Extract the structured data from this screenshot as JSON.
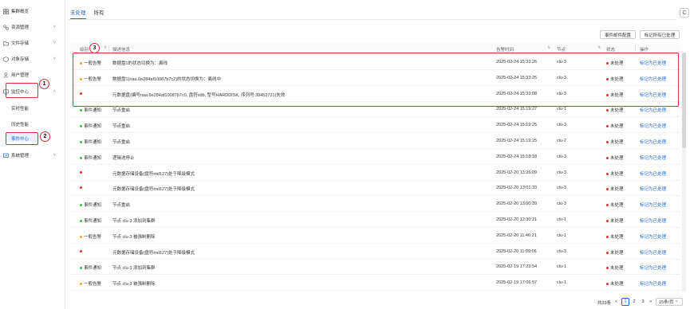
{
  "colors": {
    "accent": "#1f66d8",
    "highlight": "#d9303c",
    "level_general": "#f0a020",
    "level_notice": "#3bb54a",
    "level_red": "#e03030",
    "status_unhandled": "#e03030"
  },
  "sidebar": {
    "items": [
      {
        "label": "集群概览",
        "icon": "grid-icon",
        "chevron": ""
      },
      {
        "label": "资源管理",
        "icon": "resource-icon",
        "chevron": "˅"
      },
      {
        "label": "文件存储",
        "icon": "folder-icon",
        "chevron": "˅"
      },
      {
        "label": "对象存储",
        "icon": "object-icon",
        "chevron": "˅"
      },
      {
        "label": "用户管理",
        "icon": "user-icon",
        "chevron": ""
      },
      {
        "label": "监控中心",
        "icon": "monitor-icon",
        "chevron": "˄"
      },
      {
        "label": "系统管理",
        "icon": "settings-icon",
        "chevron": "˅"
      }
    ],
    "sub_items": [
      {
        "label": "实时性能"
      },
      {
        "label": "历史性能"
      },
      {
        "label": "事件中心"
      }
    ]
  },
  "annotations": [
    "1",
    "2",
    "3"
  ],
  "tabs": [
    {
      "label": "未处理"
    },
    {
      "label": "所有"
    }
  ],
  "refresh_label": "C",
  "toolbar": {
    "config_label": "事件邮件配置",
    "mark_all_label": "标记所有已处理"
  },
  "table": {
    "headers": {
      "level": "级别",
      "desc": "描述信息",
      "time": "告警时间",
      "node": "节点",
      "status": "状态",
      "action": "操作"
    },
    "rows": [
      {
        "level": "一般告警",
        "level_type": "general",
        "desc": "数据盘1的状态切换为：离线",
        "time": "2025-02-24 15:33:26",
        "node": "clu-3",
        "status": "未处理",
        "action": "标记为已处理"
      },
      {
        "level": "一般告警",
        "level_type": "general",
        "desc": "数据盘1(naa.6e284af10087b7c2)的状态切换为：离线中",
        "time": "2025-02-24 15:33:25",
        "node": "clu-3",
        "status": "未处理",
        "action": "标记为已处理"
      },
      {
        "level": "",
        "level_type": "red",
        "desc": "元数据盘(编号naa.6e284af10087b7c0, 盘符sdb, 型号HARDDISK, 序列号:39452721)失效",
        "time": "2025-02-24 15:33:08",
        "node": "clu-3",
        "status": "未处理",
        "action": "标记为已处理"
      },
      {
        "level": "事件通知",
        "level_type": "notice",
        "desc": "节点重启",
        "time": "2025-02-24 15:19:27",
        "node": "clu-1",
        "status": "未处理",
        "action": "标记为已处理"
      },
      {
        "level": "事件通知",
        "level_type": "notice",
        "desc": "节点重启",
        "time": "2025-02-24 15:19:25",
        "node": "clu-3",
        "status": "未处理",
        "action": "标记为已处理"
      },
      {
        "level": "事件通知",
        "level_type": "notice",
        "desc": "节点重启",
        "time": "2025-02-24 15:19:25",
        "node": "clu-2",
        "status": "未处理",
        "action": "标记为已处理"
      },
      {
        "level": "事件通知",
        "level_type": "notice",
        "desc": "逻辑池停止",
        "time": "2025-02-24 15:18:18",
        "node": "clu-3",
        "status": "未处理",
        "action": "标记为已处理"
      },
      {
        "level": "",
        "level_type": "red",
        "desc": "元数据存储设备(盘符md127)处于降级模式",
        "time": "2025-02-20 13:26:09",
        "node": "clu-3",
        "status": "未处理",
        "action": "标记为已处理"
      },
      {
        "level": "",
        "level_type": "red",
        "desc": "元数据存储设备(盘符md127)处于降级模式",
        "time": "2025-02-20 13:01:33",
        "node": "clu-3",
        "status": "未处理",
        "action": "标记为已处理"
      },
      {
        "level": "事件通知",
        "level_type": "notice",
        "desc": "节点重启",
        "time": "2025-02-20 13:00:39",
        "node": "clu-3",
        "status": "未处理",
        "action": "标记为已处理"
      },
      {
        "level": "事件通知",
        "level_type": "notice",
        "desc": "节点 clu-3 添加到集群",
        "time": "2025-02-20 12:30:21",
        "node": "clu-1",
        "status": "未处理",
        "action": "标记为已处理"
      },
      {
        "level": "一般告警",
        "level_type": "general",
        "desc": "节点 clu-3 被强制删除",
        "time": "2025-02-20 11:46:21",
        "node": "clu-1",
        "status": "未处理",
        "action": "标记为已处理"
      },
      {
        "level": "",
        "level_type": "red",
        "desc": "元数据存储设备(盘符md127)处于降级模式",
        "time": "2025-02-20 11:39:06",
        "node": "clu-3",
        "status": "未处理",
        "action": "标记为已处理"
      },
      {
        "level": "事件通知",
        "level_type": "notice",
        "desc": "节点 clu-3 添加到集群",
        "time": "2025-02-19 17:23:54",
        "node": "clu-1",
        "status": "未处理",
        "action": "标记为已处理"
      },
      {
        "level": "一般告警",
        "level_type": "general",
        "desc": "节点 clu-3 被强制删除",
        "time": "2025-02-19 17:06:57",
        "node": "clu-1",
        "status": "未处理",
        "action": "标记为已处理"
      }
    ]
  },
  "pagination": {
    "total": "共33条",
    "prev": "<",
    "pages": [
      "1",
      "2",
      "3"
    ],
    "current": "1",
    "next": ">",
    "page_size": "15条/页",
    "page_size_chevron": "˅"
  }
}
